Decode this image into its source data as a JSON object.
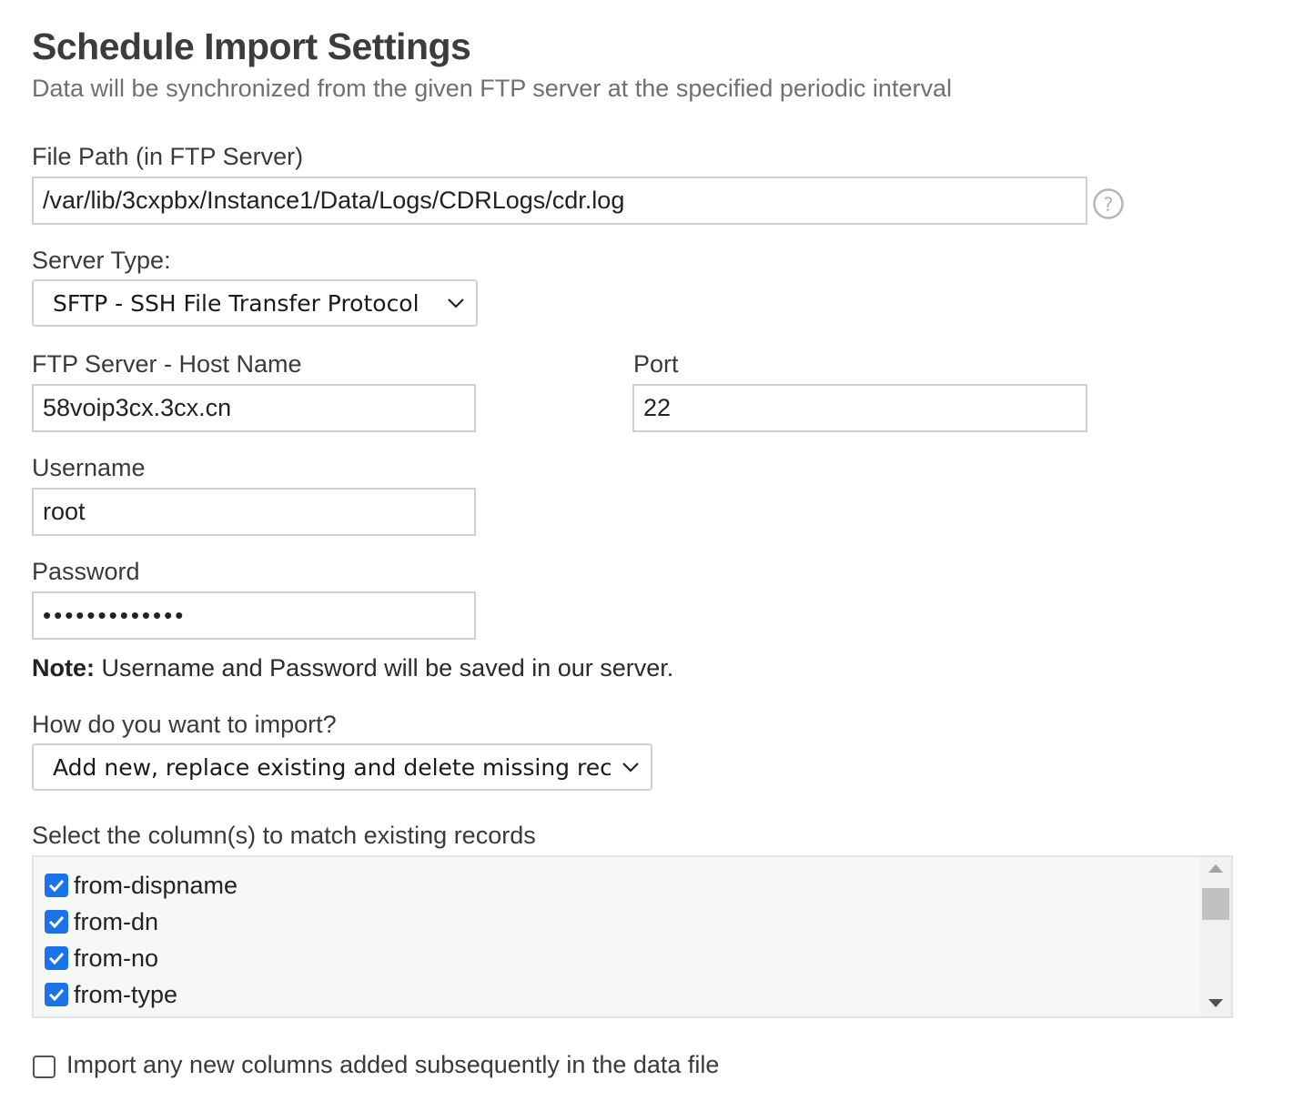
{
  "header": {
    "title": "Schedule Import Settings",
    "subtitle": "Data will be synchronized from the given FTP server at the specified periodic interval"
  },
  "file_path": {
    "label": "File Path (in FTP Server)",
    "value": "/var/lib/3cxpbx/Instance1/Data/Logs/CDRLogs/cdr.log",
    "help_icon": "question-circle-icon"
  },
  "server_type": {
    "label": "Server Type:",
    "selected": "SFTP - SSH File Transfer Protocol"
  },
  "host": {
    "label": "FTP Server - Host Name",
    "value": "58voip3cx.3cx.cn"
  },
  "port": {
    "label": "Port",
    "value": "22"
  },
  "username": {
    "label": "Username",
    "value": "root"
  },
  "password": {
    "label": "Password",
    "masked_value": "•••••••••••••"
  },
  "note": {
    "prefix": "Note:",
    "text": " Username and Password will be saved in our server."
  },
  "import_mode": {
    "label": "How do you want to import?",
    "selected": "Add new, replace existing and delete missing records"
  },
  "match_columns": {
    "label": "Select the column(s) to match existing records",
    "items": [
      {
        "label": "from-dispname",
        "checked": true
      },
      {
        "label": "from-dn",
        "checked": true
      },
      {
        "label": "from-no",
        "checked": true
      },
      {
        "label": "from-type",
        "checked": true
      }
    ]
  },
  "import_new_columns": {
    "label": "Import any new columns added subsequently in the data file",
    "checked": false
  },
  "colors": {
    "accent": "#1a73e8",
    "border": "#cfcfcf",
    "text": "#3a3a3a",
    "subtitle": "#707070"
  }
}
